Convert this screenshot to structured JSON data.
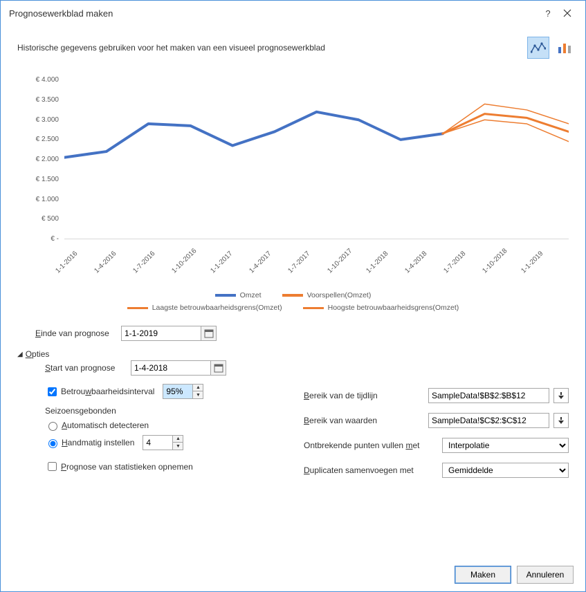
{
  "title": "Prognosewerkblad maken",
  "subtitle": "Historische gegevens gebruiken voor het maken van een visueel prognosewerkblad",
  "buttons": {
    "create": "Maken",
    "cancel": "Annuleren"
  },
  "labels": {
    "forecast_end": "Einde van prognose",
    "options": "Opties",
    "forecast_start": "Start van prognose",
    "confidence": "Betrouwbaarheidsinterval",
    "seasonal": "Seizoensgebonden",
    "auto_detect": "Automatisch detecteren",
    "manual": "Handmatig instellen",
    "include_stats": "Prognose van statistieken opnemen",
    "timeline_range": "Bereik van de tijdlijn",
    "values_range": "Bereik van waarden",
    "missing": "Ontbrekende punten vullen met",
    "duplicates": "Duplicaten samenvoegen met"
  },
  "values": {
    "forecast_end": "1-1-2019",
    "forecast_start": "1-4-2018",
    "confidence": "95%",
    "manual_period": "4",
    "timeline_range": "SampleData!$B$2:$B$12",
    "values_range": "SampleData!$C$2:$C$12",
    "missing": "Interpolatie",
    "duplicates": "Gemiddelde"
  },
  "chart_data": {
    "type": "line",
    "title": "",
    "xlabel": "",
    "ylabel": "",
    "ylim": [
      0,
      4000
    ],
    "yticks": [
      "€ 4.000",
      "€ 3.500",
      "€ 3.000",
      "€ 2.500",
      "€ 2.000",
      "€ 1.500",
      "€ 1.000",
      "€ 500",
      "€ -"
    ],
    "categories": [
      "1-1-2016",
      "1-4-2016",
      "1-7-2016",
      "1-10-2016",
      "1-1-2017",
      "1-4-2017",
      "1-7-2017",
      "1-10-2017",
      "1-1-2018",
      "1-4-2018",
      "1-7-2018",
      "1-10-2018",
      "1-1-2019"
    ],
    "series": [
      {
        "name": "Omzet",
        "color": "#4472C4",
        "width": 4,
        "values": [
          2050,
          2200,
          2900,
          2850,
          2350,
          2700,
          3200,
          3000,
          2500,
          2650,
          null,
          null,
          null
        ]
      },
      {
        "name": "Voorspellen(Omzet)",
        "color": "#ED7D31",
        "width": 3,
        "values": [
          null,
          null,
          null,
          null,
          null,
          null,
          null,
          null,
          null,
          2650,
          3150,
          3050,
          2700
        ]
      },
      {
        "name": "Laagste betrouwbaarheidsgrens(Omzet)",
        "color": "#ED7D31",
        "width": 1.5,
        "values": [
          null,
          null,
          null,
          null,
          null,
          null,
          null,
          null,
          null,
          2650,
          3000,
          2900,
          2450
        ]
      },
      {
        "name": "Hoogste betrouwbaarheidsgrens(Omzet)",
        "color": "#ED7D31",
        "width": 1.5,
        "values": [
          null,
          null,
          null,
          null,
          null,
          null,
          null,
          null,
          null,
          2650,
          3400,
          3250,
          2900
        ]
      }
    ],
    "legend_rows": [
      [
        {
          "label": "Omzet",
          "color": "#4472C4",
          "thick": true
        },
        {
          "label": "Voorspellen(Omzet)",
          "color": "#ED7D31",
          "thick": true
        }
      ],
      [
        {
          "label": "Laagste betrouwbaarheidsgrens(Omzet)",
          "color": "#ED7D31",
          "thick": false
        },
        {
          "label": "Hoogste betrouwbaarheidsgrens(Omzet)",
          "color": "#ED7D31",
          "thick": false
        }
      ]
    ]
  }
}
